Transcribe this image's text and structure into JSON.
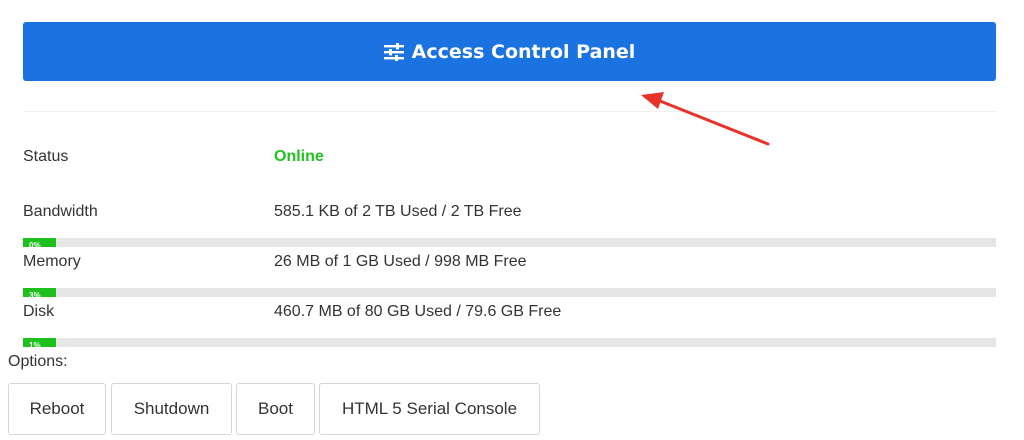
{
  "panel_button": {
    "label": "Access Control Panel",
    "icon": "sliders-icon"
  },
  "status": {
    "label": "Status",
    "value": "Online",
    "color": "#22c022"
  },
  "resources": [
    {
      "key": "bandwidth",
      "label": "Bandwidth",
      "value": "585.1 KB of 2 TB Used / 2 TB Free",
      "percent_text": "0%",
      "fill_fraction": 0.034
    },
    {
      "key": "memory",
      "label": "Memory",
      "value": "26 MB of 1 GB Used / 998 MB Free",
      "percent_text": "3%",
      "fill_fraction": 0.034
    },
    {
      "key": "disk",
      "label": "Disk",
      "value": "460.7 MB of 80 GB Used / 79.6 GB Free",
      "percent_text": "1%",
      "fill_fraction": 0.034
    }
  ],
  "options": {
    "label": "Options:",
    "buttons": [
      "Reboot",
      "Shutdown",
      "Boot",
      "HTML 5 Serial Console"
    ]
  },
  "colors": {
    "accent": "#1a73e0",
    "bar_fill": "#1ec01e",
    "arrow": "#e8332a"
  }
}
